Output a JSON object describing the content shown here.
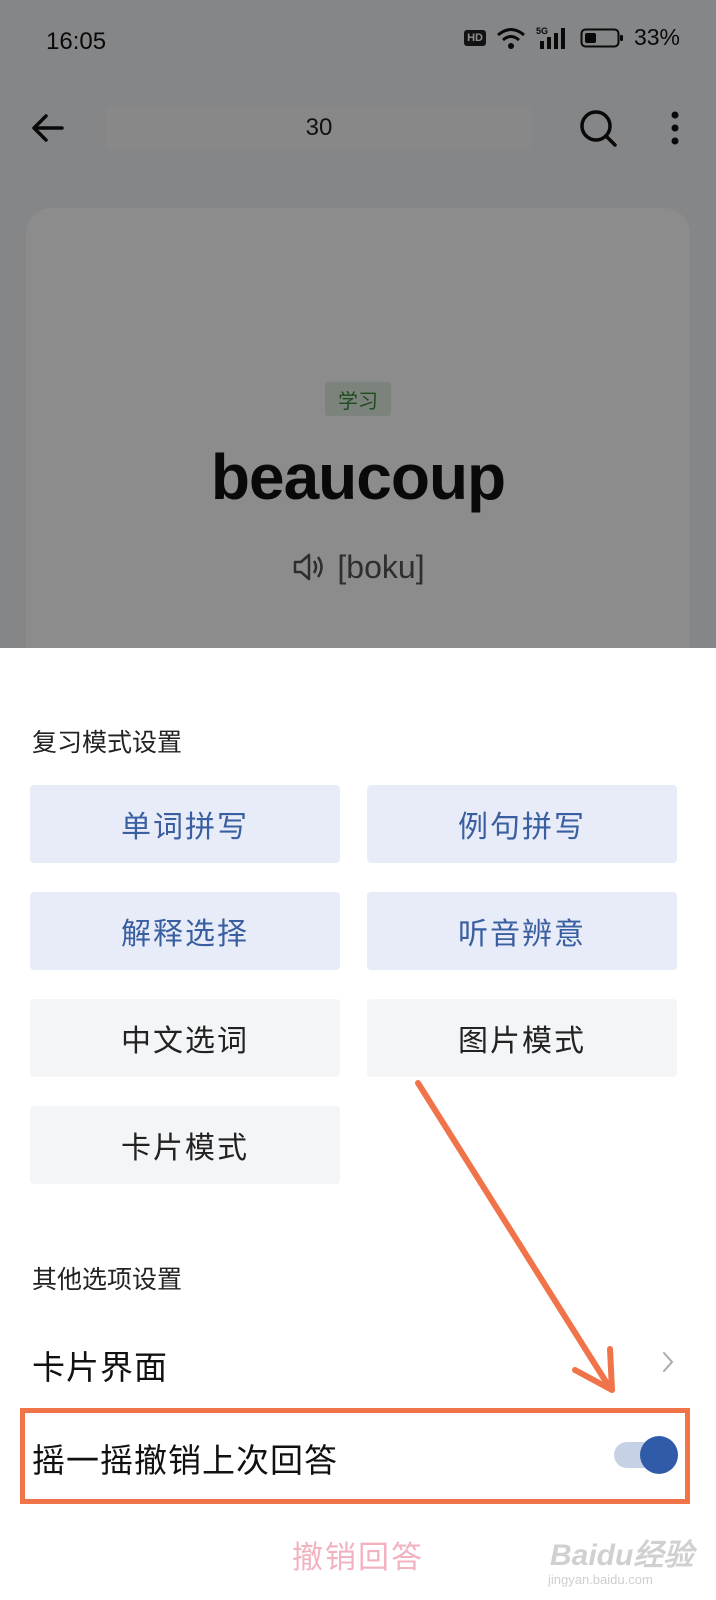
{
  "status_bar": {
    "time": "16:05",
    "hd_label": "HD",
    "network": "5G",
    "battery_percent": "33%"
  },
  "top_bar": {
    "title": "30"
  },
  "card": {
    "tag": "学习",
    "word": "beaucoup",
    "phonetic": "[boku]"
  },
  "sheet": {
    "review_section_title": "复习模式设置",
    "modes": [
      {
        "label": "单词拼写",
        "selected": true
      },
      {
        "label": "例句拼写",
        "selected": true
      },
      {
        "label": "解释选择",
        "selected": true
      },
      {
        "label": "听音辨意",
        "selected": true
      },
      {
        "label": "中文选词",
        "selected": false
      },
      {
        "label": "图片模式",
        "selected": false
      },
      {
        "label": "卡片模式",
        "selected": false
      }
    ],
    "other_section_title": "其他选项设置",
    "card_interface_label": "卡片界面",
    "shake_undo_label": "摇一摇撤销上次回答",
    "shake_undo_enabled": true,
    "undo_button": "撤销回答"
  },
  "watermark": {
    "main": "Baidu经验",
    "sub": "jingyan.baidu.com"
  },
  "colors": {
    "accent_blue": "#2f5ba8",
    "selected_mode_bg": "#e8ecf8",
    "annotation_orange": "#f0734a"
  }
}
